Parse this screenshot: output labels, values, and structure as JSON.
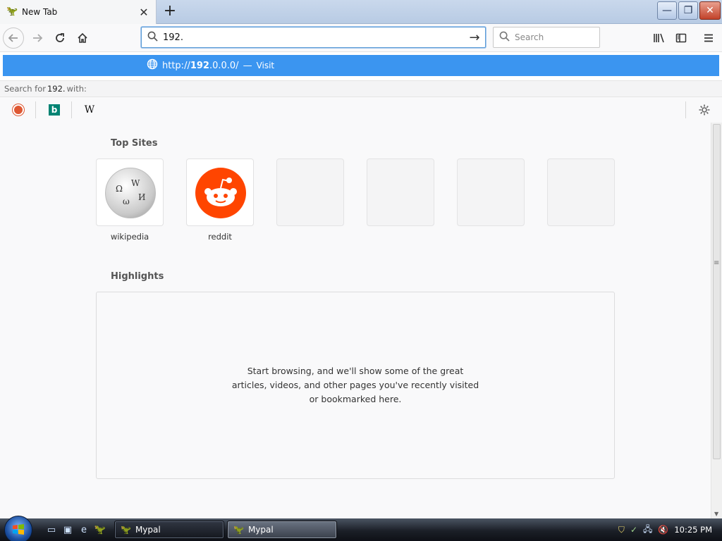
{
  "window": {
    "tab_title": "New Tab",
    "new_tab_symbol": "+",
    "controls": {
      "minimize": "—",
      "restore": "❐",
      "close": "✕"
    }
  },
  "navbar": {
    "url_value": "192.",
    "search_placeholder": "Search",
    "go_symbol": "→"
  },
  "autocomplete": {
    "suggestion_prefix": "http://",
    "suggestion_bold": "192",
    "suggestion_rest": ".0.0.0/",
    "separator": "—",
    "action": "Visit",
    "search_for_prefix": "Search for",
    "search_for_query": "192.",
    "search_for_suffix": "with:",
    "engines": [
      "duckduckgo-icon",
      "bing-icon",
      "wikipedia-icon"
    ],
    "wiki_letter": "W",
    "bing_letter": "b"
  },
  "content": {
    "top_sites_title": "Top Sites",
    "top_sites": [
      {
        "label": "wikipedia",
        "icon": "wikipedia-icon"
      },
      {
        "label": "reddit",
        "icon": "reddit-icon"
      },
      {
        "label": ""
      },
      {
        "label": ""
      },
      {
        "label": ""
      },
      {
        "label": ""
      }
    ],
    "highlights_title": "Highlights",
    "highlights_message": "Start browsing, and we'll show some of the great articles, videos, and other pages you've recently visited or bookmarked here."
  },
  "taskbar": {
    "buttons": [
      {
        "label": "Mypal",
        "active": true
      },
      {
        "label": "Mypal",
        "active": false
      }
    ],
    "clock": "10:25 PM"
  },
  "colors": {
    "accent": "#3b95f0",
    "reddit": "#ff4500",
    "bing": "#008373",
    "duckduckgo": "#de5833"
  }
}
